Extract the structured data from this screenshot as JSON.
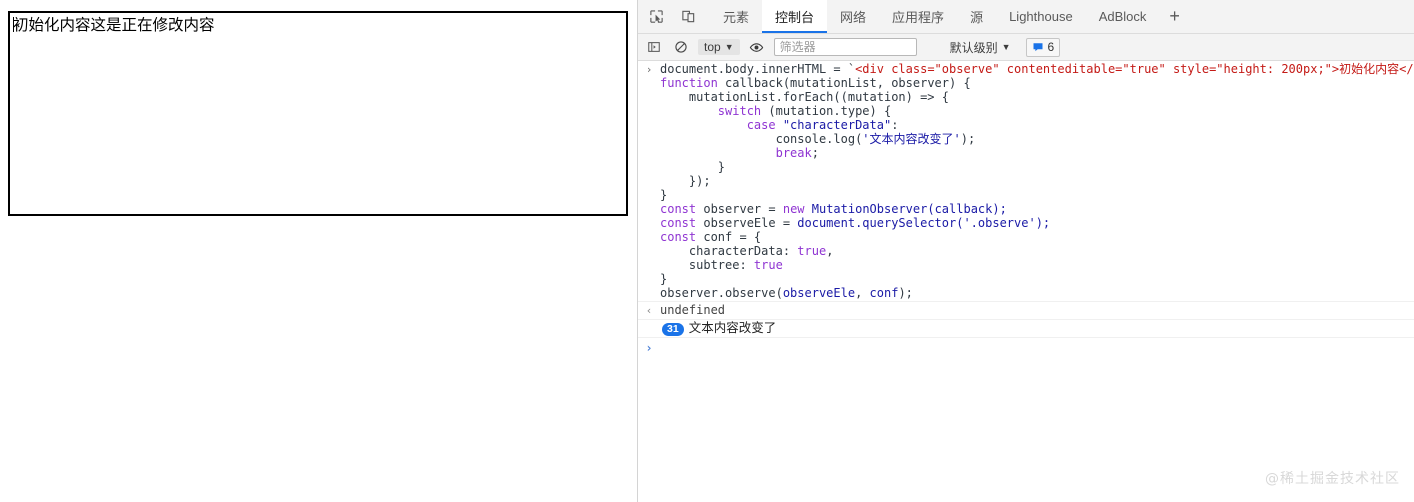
{
  "page": {
    "editable_div_text": "初始化内容这是正在修改内容"
  },
  "devtools": {
    "icons": {
      "inspect": "inspect-cursor-icon",
      "device": "device-toolbar-icon"
    },
    "tabs": [
      {
        "label": "元素",
        "active": false
      },
      {
        "label": "控制台",
        "active": true
      },
      {
        "label": "网络",
        "active": false
      },
      {
        "label": "应用程序",
        "active": false
      },
      {
        "label": "源",
        "active": false
      },
      {
        "label": "Lighthouse",
        "active": false
      },
      {
        "label": "AdBlock",
        "active": false
      }
    ],
    "add_tab_label": "+",
    "filterbar": {
      "sidebar_toggle": "sidebar-toggle-icon",
      "clear_console": "clear-console-icon",
      "context_label": "top",
      "eye_icon": "eye-icon",
      "filter_placeholder": "筛选器",
      "filter_value": "",
      "level_label": "默认级别",
      "message_count": "6"
    },
    "accent_color": "#1a73e8",
    "console": {
      "input_lines": [
        [
          {
            "t": "document.body.innerHTML = ",
            "c": "id"
          },
          {
            "t": "`",
            "c": "id"
          },
          {
            "t": "<div class=\"observe\" contenteditable=\"true\" style=\"height: 200px;\">初始化内容</div>",
            "c": "str-red"
          },
          {
            "t": "`;",
            "c": "id"
          }
        ],
        [
          {
            "t": "function ",
            "c": "k"
          },
          {
            "t": "callback(mutationList, observer) {",
            "c": "id"
          }
        ],
        [
          {
            "t": "    mutationList.forEach((mutation) => {",
            "c": "id"
          }
        ],
        [
          {
            "t": "        switch ",
            "c": "k"
          },
          {
            "t": "(mutation.type) {",
            "c": "id"
          }
        ],
        [
          {
            "t": "            case ",
            "c": "k"
          },
          {
            "t": "\"characterData\"",
            "c": "s"
          },
          {
            "t": ":",
            "c": "id"
          }
        ],
        [
          {
            "t": "                console.log(",
            "c": "id"
          },
          {
            "t": "'文本内容改变了'",
            "c": "s"
          },
          {
            "t": ");",
            "c": "id"
          }
        ],
        [
          {
            "t": "                break",
            "c": "k"
          },
          {
            "t": ";",
            "c": "id"
          }
        ],
        [
          {
            "t": "        }",
            "c": "id"
          }
        ],
        [
          {
            "t": "    });",
            "c": "id"
          }
        ],
        [
          {
            "t": "}",
            "c": "id"
          }
        ],
        [
          {
            "t": "const ",
            "c": "k"
          },
          {
            "t": "observer = ",
            "c": "id"
          },
          {
            "t": "new ",
            "c": "k"
          },
          {
            "t": "MutationObserver(callback);",
            "c": "s"
          }
        ],
        [
          {
            "t": "const ",
            "c": "k"
          },
          {
            "t": "observeEle = ",
            "c": "id"
          },
          {
            "t": "document.querySelector(",
            "c": "s"
          },
          {
            "t": "'.observe'",
            "c": "s"
          },
          {
            "t": ");",
            "c": "s"
          }
        ],
        [
          {
            "t": "const ",
            "c": "k"
          },
          {
            "t": "conf = {",
            "c": "id"
          }
        ],
        [
          {
            "t": "    characterData: ",
            "c": "id"
          },
          {
            "t": "true",
            "c": "k"
          },
          {
            "t": ",",
            "c": "id"
          }
        ],
        [
          {
            "t": "    subtree: ",
            "c": "id"
          },
          {
            "t": "true",
            "c": "k"
          }
        ],
        [
          {
            "t": "}",
            "c": "id"
          }
        ],
        [
          {
            "t": "observer.observe(",
            "c": "id"
          },
          {
            "t": "observeEle",
            "c": "s"
          },
          {
            "t": ", ",
            "c": "id"
          },
          {
            "t": "conf",
            "c": "s"
          },
          {
            "t": ");",
            "c": "id"
          }
        ]
      ],
      "result_value": "undefined",
      "repeat_count": "31",
      "repeat_message": "文本内容改变了",
      "prompt_value": ""
    }
  },
  "watermark": "@稀土掘金技术社区"
}
